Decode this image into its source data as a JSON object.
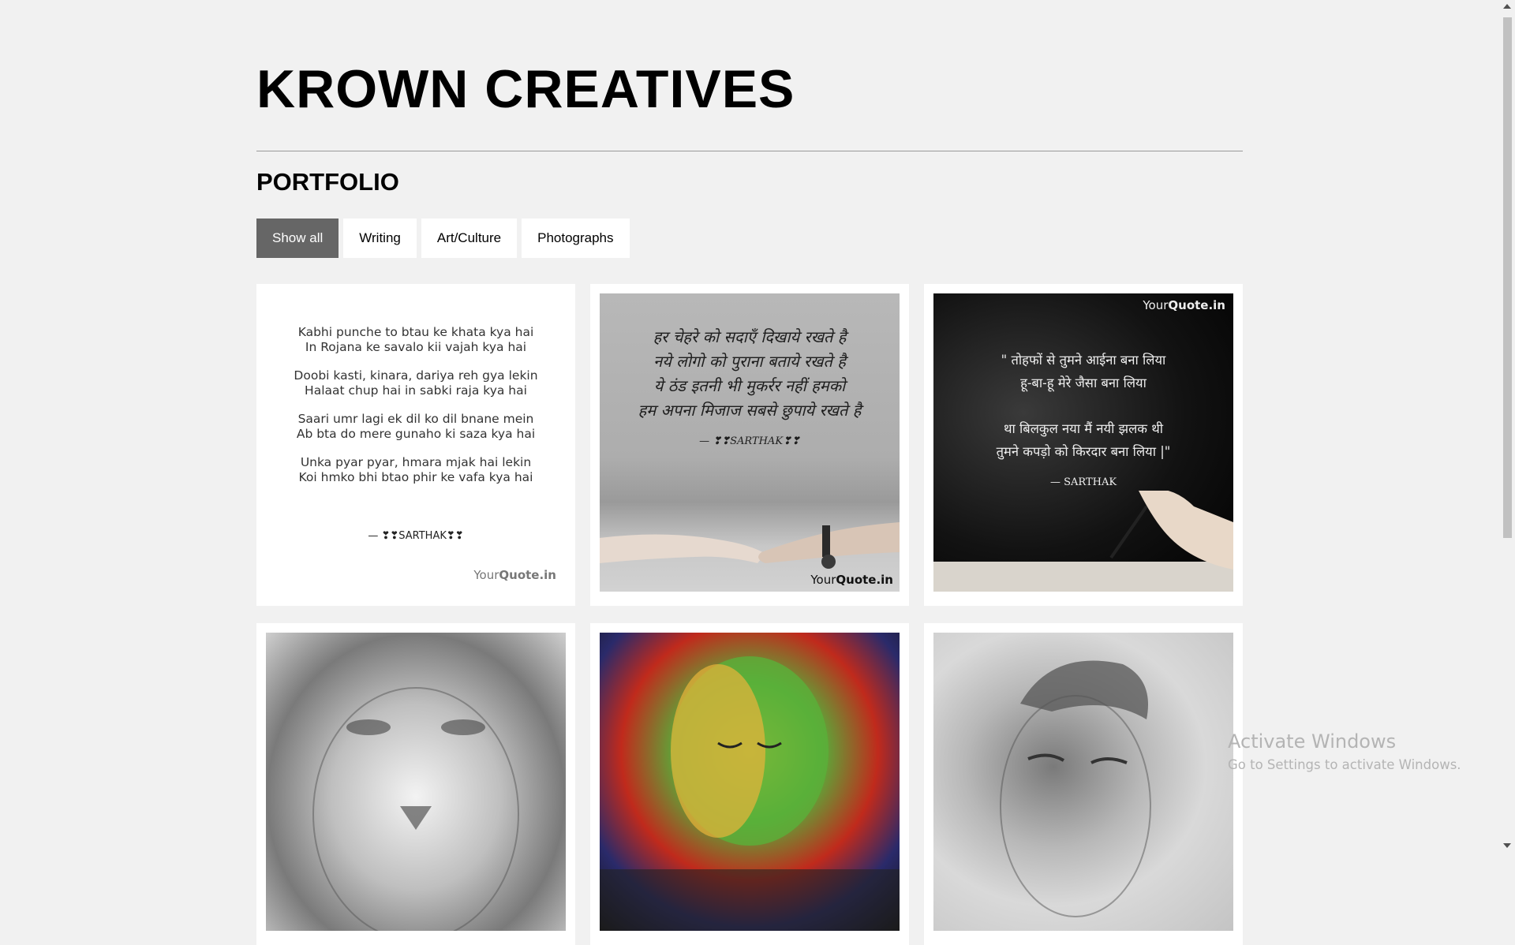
{
  "site": {
    "title": "KROWN CREATIVES"
  },
  "portfolio": {
    "heading": "PORTFOLIO",
    "filters": [
      "Show all",
      "Writing",
      "Art/Culture",
      "Photographs"
    ],
    "active_filter": "Show all"
  },
  "cards": {
    "c1": {
      "lines": [
        "Kabhi punche to btau ke khata kya hai",
        "In Rojana ke savalo kii vajah kya hai",
        "Doobi kasti, kinara, dariya reh gya lekin",
        "Halaat chup hai in sabki raja kya hai",
        "Saari umr lagi ek dil ko dil bnane mein",
        "Ab bta do mere gunaho ki saza kya hai",
        "Unka pyar pyar, hmara mjak hai lekin",
        "Koi hmko bhi btao phir ke vafa kya hai"
      ],
      "signature": "— ❣❣SARTHAK❣❣",
      "brand_light": "Your",
      "brand_bold": "Quote.in"
    },
    "c2": {
      "lines": [
        "हर चेहरे को सदाएँ दिखाये रखते है",
        "नये लोगो को पुराना बताये रखते है",
        "ये ठंड इतनी भी मुकर्रर नहीं हमको",
        "हम अपना मिजाज सबसे छुपाये रखते है"
      ],
      "signature": "— ❣❣SARTHAK❣❣",
      "brand_light": "Your",
      "brand_bold": "Quote.in"
    },
    "c3": {
      "lines": [
        "\" तोहफों से तुमने आईना बना लिया",
        "हू-बा-हू मेरे जैसा बना लिया",
        "था बिलकुल नया मैं नयी झलक थी",
        "तुमने कपड़ो को किरदार बना लिया |\""
      ],
      "signature": "— SARTHAK",
      "brand_light": "Your",
      "brand_bold": "Quote.in"
    }
  },
  "os_watermark": {
    "line1": "Activate Windows",
    "line2": "Go to Settings to activate Windows."
  },
  "colors": {
    "background": "#f1f1f1",
    "active_filter_bg": "#666666",
    "card_bg": "#ffffff"
  }
}
